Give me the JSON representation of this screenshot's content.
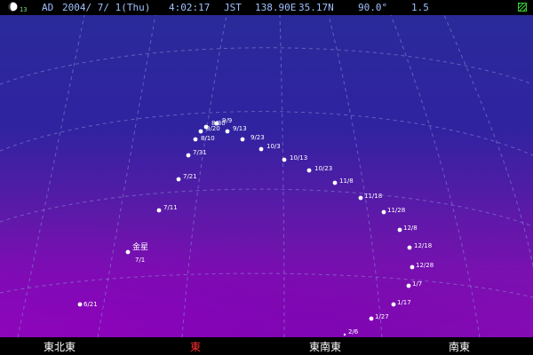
{
  "status": {
    "moon_age": "13",
    "era": "AD",
    "date": "2004/ 7/ 1(Thu)",
    "time": "4:02:17",
    "timezone": "JST",
    "longitude": "138.90E",
    "latitude": "35.17N",
    "angle": "90.0°",
    "magnitude": "1.5",
    "moon_icon": "moon-phase-icon",
    "grid_icon": "grid-toggle-icon"
  },
  "planet_name": "金星",
  "path_points": [
    {
      "date": "6/21"
    },
    {
      "date": "7/1"
    },
    {
      "date": "7/11"
    },
    {
      "date": "7/21"
    },
    {
      "date": "7/31"
    },
    {
      "date": "8/10"
    },
    {
      "date": "8/20"
    },
    {
      "date": "8/30"
    },
    {
      "date": "9/9"
    },
    {
      "date": "9/13"
    },
    {
      "date": "9/23"
    },
    {
      "date": "10/3"
    },
    {
      "date": "10/13"
    },
    {
      "date": "10/23"
    },
    {
      "date": "11/8"
    },
    {
      "date": "11/18"
    },
    {
      "date": "11/28"
    },
    {
      "date": "12/8"
    },
    {
      "date": "12/18"
    },
    {
      "date": "12/28"
    },
    {
      "date": "1/7"
    },
    {
      "date": "1/17"
    },
    {
      "date": "1/27"
    },
    {
      "date": "2/6"
    }
  ],
  "directions": [
    {
      "label": "東北東"
    },
    {
      "label": "東"
    },
    {
      "label": "東南東"
    },
    {
      "label": "南東"
    }
  ],
  "colors": {
    "status_text": "#9fc0ff",
    "east_direction": "#ff3030",
    "grid": "#8b92d8",
    "sky_top": "#2a2a9a",
    "sky_bottom": "#8a0cb6"
  }
}
